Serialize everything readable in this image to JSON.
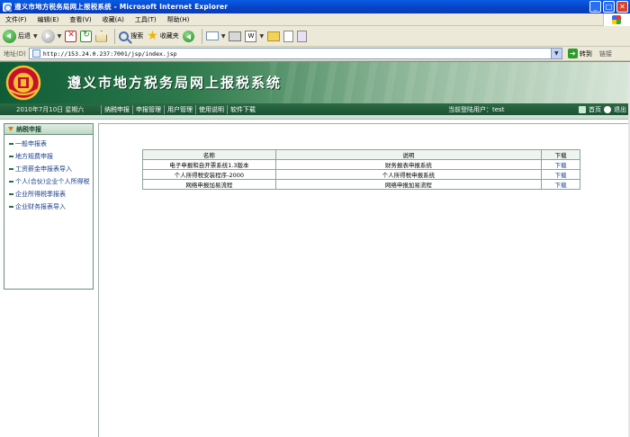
{
  "window": {
    "title": "遵义市地方税务局网上报税系统 - Microsoft Internet Explorer",
    "buttons": [
      "_",
      "□",
      "✕"
    ]
  },
  "menu": [
    "文件(F)",
    "编辑(E)",
    "查看(V)",
    "收藏(A)",
    "工具(T)",
    "帮助(H)"
  ],
  "toolbar": {
    "back_label": "后退",
    "search_label": "搜索",
    "favorites_label": "收藏夹"
  },
  "address": {
    "label": "地址(D)",
    "url": "http://153.24.0.237:7001/jsp/index.jsp",
    "go_label": "转到",
    "links_label": "链接"
  },
  "site": {
    "title": "遵义市地方税务局网上报税系统",
    "date": "2010年7月10日  星期六",
    "nav": [
      "纳税申报",
      "申报管理",
      "用户管理",
      "使用说明",
      "软件下载"
    ],
    "user": "当前登陆用户：test",
    "home_label": "首页",
    "exit_label": "退出"
  },
  "sidebar": {
    "title": "纳税申报",
    "items": [
      {
        "label": "一般申报表"
      },
      {
        "label": "地方规费申报"
      },
      {
        "label": "工资薪金申报表导入"
      },
      {
        "label": "个人(合伙)企业个人所得税"
      },
      {
        "label": "企业所得税季报表"
      },
      {
        "label": "企业财务报表导入"
      }
    ]
  },
  "downloads": {
    "headers": [
      "名称",
      "说明",
      "下载"
    ],
    "rows": [
      {
        "name": "电子申报和自开票系统1.3版本",
        "desc": "财务报表申报系统",
        "action": "下载"
      },
      {
        "name": "个人所得税安装程序-2000",
        "desc": "个人所得税申报系统",
        "action": "下载"
      },
      {
        "name": "网络申报加易流程",
        "desc": "网络申报加易流程",
        "action": "下载"
      }
    ]
  },
  "colors": {
    "title_bar": "#0842c4",
    "banner_green": "#0f5c37",
    "nav_green": "#1c5233",
    "link_blue": "#1b3f8a"
  }
}
